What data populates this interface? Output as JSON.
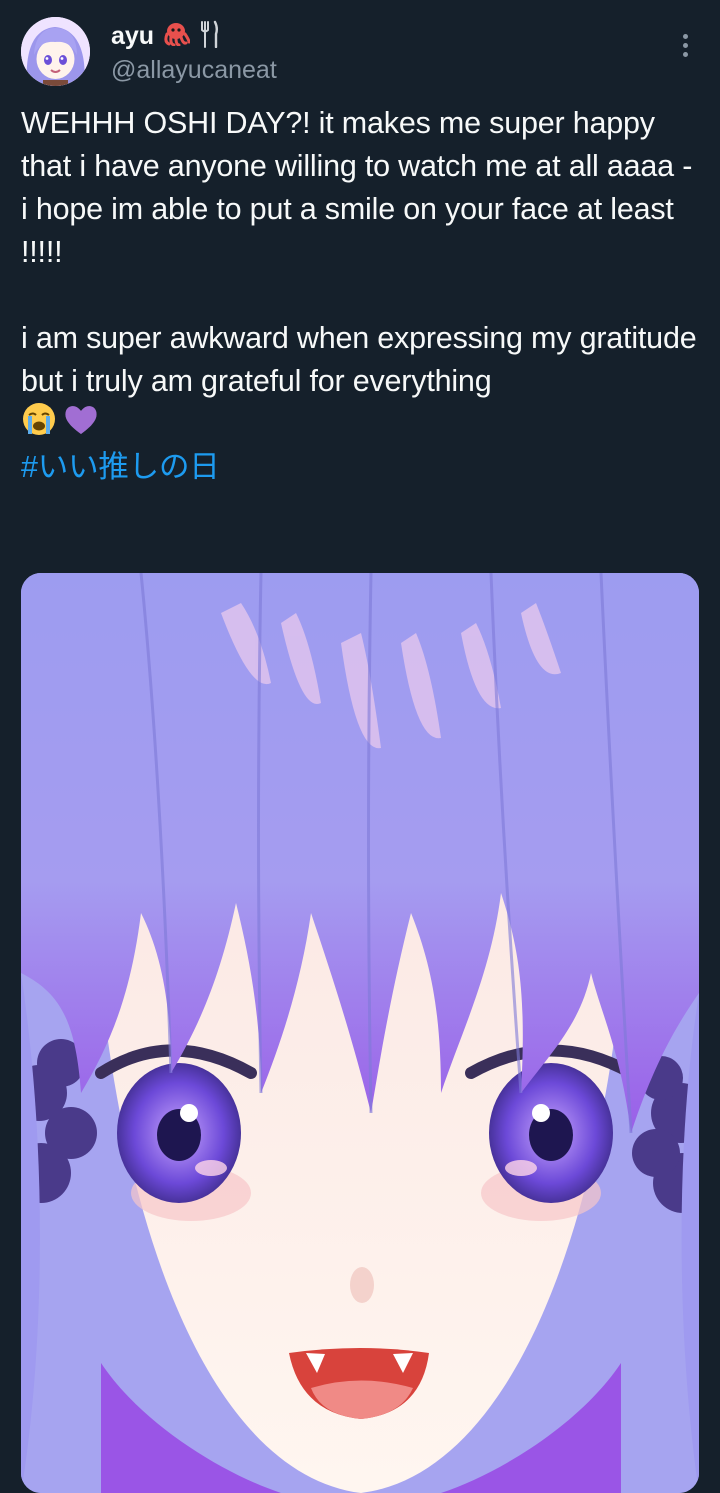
{
  "author": {
    "display_name": "ayu",
    "name_emojis": [
      "octopus-emoji",
      "fork-and-knife-emoji"
    ],
    "handle": "@allayucaneat",
    "avatar": "avatar-image"
  },
  "tweet": {
    "paragraph1": "WEHHH OSHI DAY?! it makes me super happy that i have anyone willing to watch me at all aaaa - i hope im able to put a smile on your face at least !!!!!",
    "paragraph2": "i am super awkward when expressing my gratitude but i truly am grateful for everything",
    "emojis": [
      "loudly-crying-face-emoji",
      "purple-heart-emoji"
    ],
    "hashtag": "#いい推しの日"
  },
  "media": {
    "type": "image",
    "subject": "anime-character-closeup"
  },
  "colors": {
    "background": "#15202b",
    "text": "#f7f9f9",
    "secondary_text": "#8b98a5",
    "link": "#1d9bf0"
  }
}
